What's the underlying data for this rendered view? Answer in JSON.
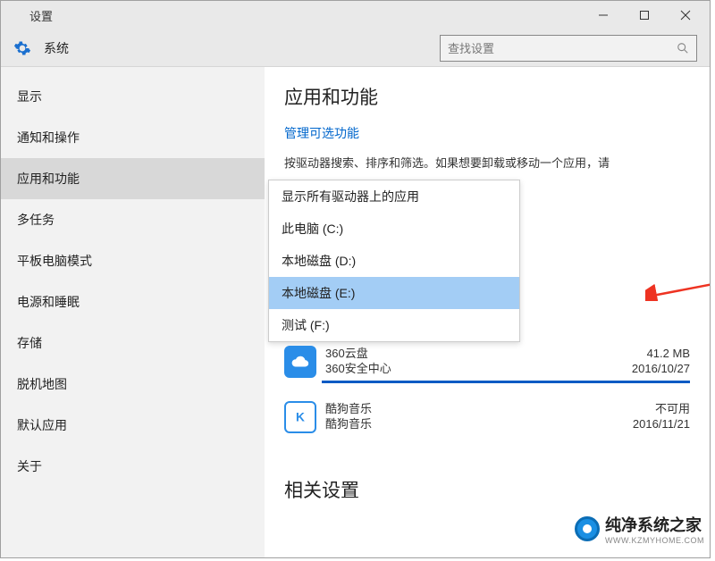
{
  "titlebar": {
    "title": "设置"
  },
  "subheader": {
    "title": "系统"
  },
  "search": {
    "placeholder": "查找设置"
  },
  "sidebar": {
    "items": [
      {
        "label": "显示"
      },
      {
        "label": "通知和操作"
      },
      {
        "label": "应用和功能"
      },
      {
        "label": "多任务"
      },
      {
        "label": "平板电脑模式"
      },
      {
        "label": "电源和睡眠"
      },
      {
        "label": "存储"
      },
      {
        "label": "脱机地图"
      },
      {
        "label": "默认应用"
      },
      {
        "label": "关于"
      }
    ],
    "active_index": 2
  },
  "main": {
    "heading": "应用和功能",
    "link": "管理可选功能",
    "desc": "按驱动器搜索、排序和筛选。如果想要卸载或移动一个应用，请",
    "heading2": "相关设置"
  },
  "dropdown": {
    "items": [
      "显示所有驱动器上的应用",
      "此电脑 (C:)",
      "本地磁盘 (D:)",
      "本地磁盘 (E:)",
      "测试 (F:)"
    ],
    "selected_index": 3
  },
  "apps": [
    {
      "name": "360云盘",
      "publisher": "360安全中心",
      "size": "41.2 MB",
      "date": "2016/10/27",
      "icon": "cloud",
      "highlighted": true
    },
    {
      "name": "酷狗音乐",
      "publisher": "酷狗音乐",
      "size": "不可用",
      "date": "2016/11/21",
      "icon": "k",
      "highlighted": false
    }
  ],
  "watermark": {
    "text": "纯净系统之家",
    "sub": "WWW.KZMYHOME.COM"
  }
}
